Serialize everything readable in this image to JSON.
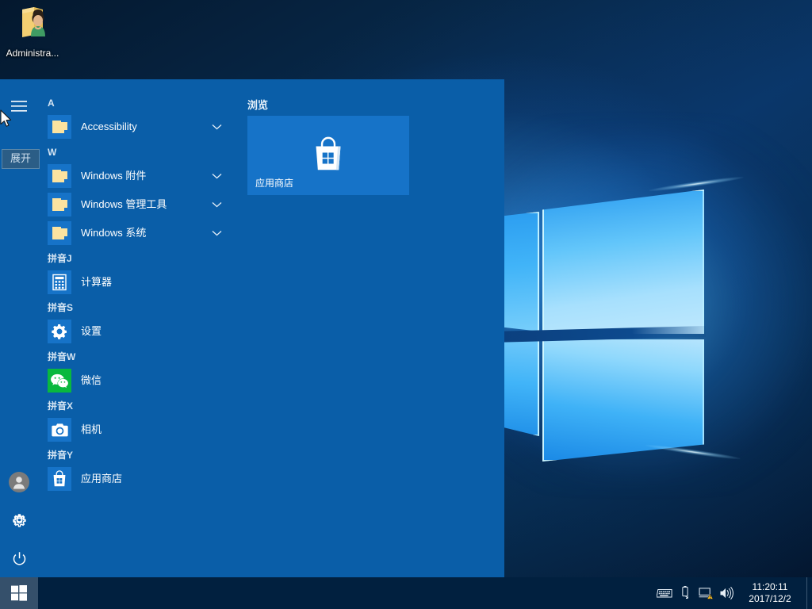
{
  "desktop": {
    "icon": {
      "name": "administrator-folder-icon",
      "label": "Administra..."
    },
    "wallpaper_name": "windows-10-hero-wallpaper"
  },
  "start_menu": {
    "tooltip": {
      "text": "展开",
      "target": "hamburger-menu"
    },
    "rail": {
      "hamburger_label": "展开",
      "user_label": "Administrator",
      "settings_label": "设置",
      "power_label": "电源"
    },
    "app_list": {
      "groups": [
        {
          "header": "A",
          "apps": [
            {
              "label": "Accessibility",
              "icon": "folder-icon",
              "expandable": true
            }
          ]
        },
        {
          "header": "W",
          "apps": [
            {
              "label": "Windows 附件",
              "icon": "folder-icon",
              "expandable": true
            },
            {
              "label": "Windows 管理工具",
              "icon": "folder-icon",
              "expandable": true
            },
            {
              "label": "Windows 系统",
              "icon": "folder-icon",
              "expandable": true
            }
          ]
        },
        {
          "header": "拼音J",
          "apps": [
            {
              "label": "计算器",
              "icon": "calculator-icon",
              "expandable": false
            }
          ]
        },
        {
          "header": "拼音S",
          "apps": [
            {
              "label": "设置",
              "icon": "gear-icon",
              "expandable": false
            }
          ]
        },
        {
          "header": "拼音W",
          "apps": [
            {
              "label": "微信",
              "icon": "wechat-icon",
              "expandable": false
            }
          ]
        },
        {
          "header": "拼音X",
          "apps": [
            {
              "label": "相机",
              "icon": "camera-icon",
              "expandable": false
            }
          ]
        },
        {
          "header": "拼音Y",
          "apps": [
            {
              "label": "应用商店",
              "icon": "store-icon",
              "expandable": false
            }
          ]
        }
      ]
    },
    "tiles": {
      "group_title": "浏览",
      "items": [
        {
          "label": "应用商店",
          "icon": "store-bag-icon",
          "size": "wide"
        }
      ]
    }
  },
  "taskbar": {
    "start_button_label": "开始",
    "tray_icons": [
      {
        "name": "touch-keyboard-icon"
      },
      {
        "name": "usb-eject-icon"
      },
      {
        "name": "network-warning-icon"
      },
      {
        "name": "volume-icon"
      }
    ],
    "clock": {
      "time": "11:20:11",
      "date": "2017/12/2"
    }
  },
  "colors": {
    "menu_blue": "#0A5EA8",
    "tile_blue": "#1673C8",
    "taskbar": "#01203f",
    "start_hover": "#35506b",
    "wechat_green": "#09B83E",
    "folder_yellow": "#FBE3A0"
  }
}
